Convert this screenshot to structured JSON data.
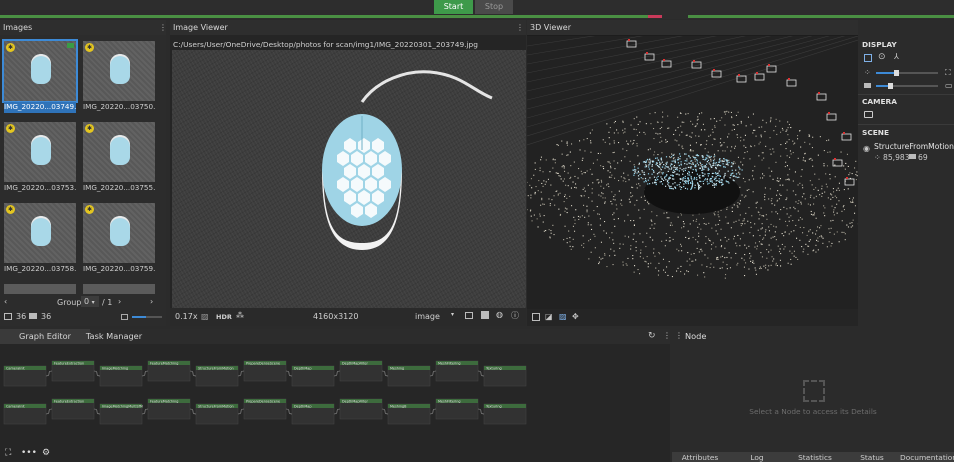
{
  "toolbar": {
    "start_label": "Start",
    "stop_label": "Stop"
  },
  "images": {
    "title": "Images",
    "thumbnails": [
      {
        "caption": "IMG_20220...03749.jpg",
        "selected": true
      },
      {
        "caption": "IMG_20220...03750.jpg",
        "selected": false
      },
      {
        "caption": "IMG_20220...03753.jpg",
        "selected": false
      },
      {
        "caption": "IMG_20220...03755.jpg",
        "selected": false
      },
      {
        "caption": "IMG_20220...03758.jpg",
        "selected": false
      },
      {
        "caption": "IMG_20220...03759.jpg",
        "selected": false
      }
    ],
    "group_label": "Group",
    "group_value": "0",
    "group_total": "/ 1",
    "image_count": "36",
    "camera_count": "36"
  },
  "viewer": {
    "title": "Image Viewer",
    "path": "C:/Users/User/OneDrive/Desktop/photos for scan/img1/IMG_20220301_203749.jpg",
    "zoom": "0.17x",
    "hdr_label": "HDR",
    "resolution": "4160x3120",
    "mode": "image"
  },
  "threed": {
    "title": "3D Viewer",
    "display_label": "DISPLAY",
    "camera_label": "CAMERA",
    "scene_label": "SCENE",
    "scene_item": "StructureFromMotion2",
    "points": "85,983",
    "cameras": "69"
  },
  "graph": {
    "tab_graph": "Graph Editor",
    "tab_task": "Task Manager",
    "nodes_row1": [
      "CameraInit",
      "FeatureExtraction",
      "ImageMatching",
      "FeatureMatching",
      "StructureFromMotion",
      "PrepareDenseScene",
      "DepthMap",
      "DepthMapFilter",
      "Meshing",
      "MeshFiltering",
      "Texturing"
    ],
    "nodes_row2": [
      "CameraInit",
      "FeatureExtraction",
      "ImageMatchingMultiSfM",
      "FeatureMatching",
      "StructureFromMotion",
      "PrepareDenseScene",
      "DepthMap",
      "DepthMapFilter",
      "MeshingB",
      "MeshFiltering",
      "Texturing"
    ]
  },
  "node_panel": {
    "title": "Node",
    "hint": "Select a Node to access its Details",
    "tabs": [
      "Attributes",
      "Log",
      "Statistics",
      "Status",
      "Documentation"
    ]
  },
  "colors": {
    "accent": "#3e9a4a",
    "select": "#2f73b9",
    "badge": "#e4c620",
    "node_header": "#3d6b3d"
  }
}
